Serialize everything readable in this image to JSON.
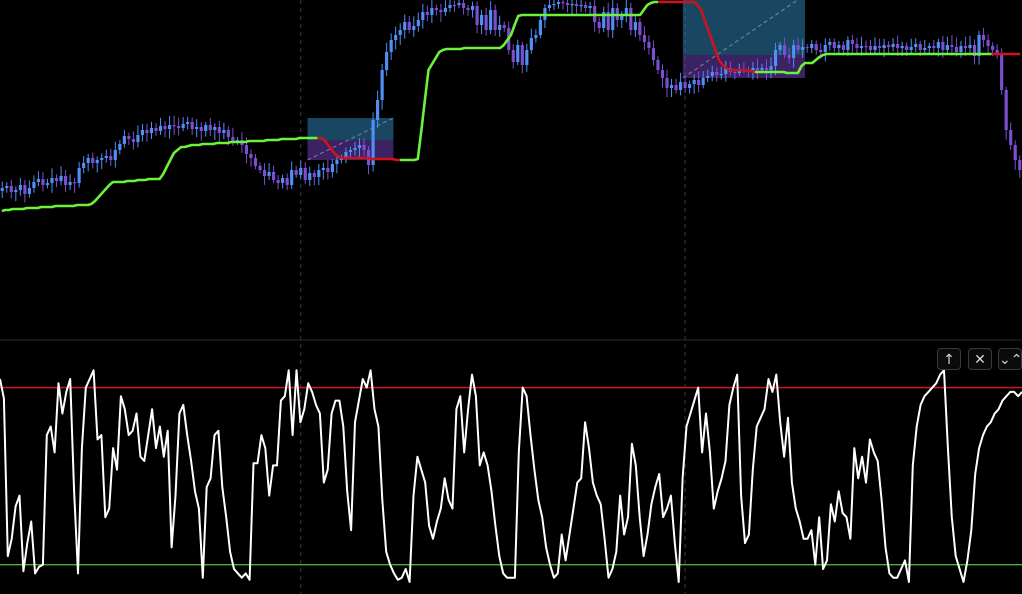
{
  "colors": {
    "background": "#000000",
    "bull_candle": "#4f8ff7",
    "bear_candle": "#7b4fd0",
    "trail_up": "#6cf23a",
    "trail_down": "#d0121f",
    "osc_line": "#ffffff",
    "upper_level": "#c41a1a",
    "lower_level": "#4caf33",
    "box_top": "#2d7fb0",
    "box_bottom": "#6b3fb5",
    "grid": "#3a3a3a"
  },
  "pane_buttons": [
    {
      "name": "move-up-icon",
      "glyph": "↑"
    },
    {
      "name": "close-icon",
      "glyph": "✕"
    },
    {
      "name": "collapse-icon",
      "glyph": "⌄⌃"
    }
  ],
  "chart_data": [
    {
      "type": "candlestick",
      "title": "",
      "price_close": [
        188,
        186,
        192,
        190,
        185,
        194,
        188,
        182,
        179,
        185,
        183,
        178,
        181,
        176,
        185,
        182,
        183,
        168,
        163,
        158,
        163,
        160,
        158,
        156,
        160,
        150,
        144,
        136,
        139,
        142,
        135,
        130,
        133,
        128,
        131,
        126,
        129,
        125,
        126,
        128,
        124,
        122,
        129,
        127,
        131,
        125,
        130,
        127,
        133,
        130,
        137,
        141,
        140,
        145,
        154,
        158,
        166,
        170,
        176,
        172,
        180,
        183,
        178,
        185,
        170,
        175,
        168,
        180,
        173,
        177,
        170,
        168,
        172,
        164,
        160,
        158,
        152,
        150,
        148,
        145,
        150,
        165,
        120,
        100,
        70,
        52,
        40,
        35,
        30,
        22,
        30,
        26,
        20,
        12,
        15,
        8,
        10,
        12,
        8,
        5,
        5,
        3,
        8,
        10,
        6,
        25,
        15,
        30,
        10,
        30,
        25,
        28,
        50,
        62,
        45,
        65,
        50,
        38,
        35,
        20,
        8,
        5,
        4,
        2,
        3,
        5,
        4,
        6,
        5,
        8,
        6,
        22,
        28,
        12,
        30,
        8,
        20,
        15,
        8,
        30,
        22,
        35,
        42,
        48,
        60,
        70,
        78,
        88,
        85,
        90,
        82,
        88,
        84,
        80,
        85,
        78,
        76,
        72,
        75,
        74,
        68,
        72,
        73,
        70,
        70,
        72,
        68,
        70,
        68,
        70,
        66,
        50,
        45,
        55,
        58,
        45,
        50,
        47,
        48,
        44,
        50,
        52,
        45,
        42,
        48,
        45,
        50,
        40,
        44,
        48,
        46,
        46,
        50,
        46,
        48,
        45,
        47,
        44,
        48,
        46,
        50,
        47,
        44,
        50,
        48,
        46,
        48,
        42,
        50,
        45,
        47,
        52,
        46,
        48,
        45,
        56,
        35,
        40,
        46,
        50,
        55,
        90,
        130,
        145,
        160,
        170
      ],
      "trail_stop": [
        211,
        210,
        210,
        209,
        209,
        209,
        209,
        208,
        208,
        208,
        208,
        207,
        207,
        207,
        207,
        206,
        206,
        206,
        206,
        206,
        206,
        205,
        205,
        205,
        205,
        204,
        201,
        197,
        193,
        189,
        185,
        182,
        182,
        182,
        182,
        181,
        181,
        181,
        180,
        180,
        180,
        179,
        179,
        179,
        179,
        174,
        167,
        160,
        153,
        150,
        147,
        147,
        146,
        145,
        145,
        145,
        144,
        144,
        144,
        144,
        143,
        143,
        143,
        143,
        142,
        142,
        142,
        142,
        142,
        141,
        141,
        141,
        141,
        141,
        140,
        140,
        140,
        140,
        139,
        139,
        139,
        139,
        139,
        138,
        138,
        138,
        138,
        138,
        138,
        138,
        140,
        145,
        150,
        154,
        157,
        158,
        158,
        158,
        158,
        158,
        158,
        158,
        158,
        159,
        159,
        159,
        159,
        159,
        159,
        159,
        160,
        160,
        160,
        160,
        160,
        160,
        159,
        130,
        100,
        70,
        64,
        58,
        52,
        50,
        49,
        49,
        49,
        49,
        49,
        48,
        48,
        48,
        48,
        48,
        48,
        48,
        48,
        48,
        48,
        48,
        45,
        40,
        35,
        25,
        16,
        15,
        15,
        15,
        15,
        15,
        15,
        15,
        15,
        15,
        15,
        15,
        15,
        15,
        15,
        15,
        15,
        15,
        15,
        15,
        15,
        15,
        15,
        15,
        15,
        15,
        15,
        15,
        15,
        15,
        15,
        15,
        15,
        15,
        15,
        10,
        5,
        3,
        2,
        2,
        2,
        2,
        2,
        2,
        2,
        2,
        2,
        2,
        2,
        2,
        5,
        10,
        20,
        30,
        40,
        50,
        60,
        65,
        68,
        70,
        70,
        70,
        70,
        70,
        71,
        71,
        72,
        72,
        72,
        72,
        72,
        72,
        72,
        72,
        72,
        73,
        73,
        73,
        73,
        66,
        63,
        63,
        63,
        60,
        57,
        55,
        54,
        54,
        54,
        54,
        54,
        54,
        54,
        54,
        54,
        54,
        54,
        54,
        54,
        54,
        54,
        54,
        54,
        54,
        54,
        54,
        54,
        54,
        54,
        54,
        54,
        54,
        54,
        54,
        54,
        54,
        54,
        54,
        54,
        54,
        54,
        54,
        54,
        54,
        54,
        54,
        54,
        54,
        54,
        54,
        54,
        54,
        54,
        54,
        54,
        54,
        54,
        54,
        54,
        54,
        54
      ],
      "trail_trend": [
        "up",
        "up",
        "up",
        "up",
        "up",
        "up",
        "up",
        "up",
        "up",
        "up",
        "up",
        "up",
        "up",
        "up",
        "up",
        "up",
        "up",
        "up",
        "up",
        "up",
        "up",
        "up",
        "up",
        "up",
        "up",
        "up",
        "up",
        "up",
        "up",
        "up",
        "up",
        "up",
        "up",
        "up",
        "up",
        "up",
        "up",
        "up",
        "up",
        "up",
        "up",
        "up",
        "up",
        "up",
        "up",
        "up",
        "up",
        "up",
        "up",
        "up",
        "up",
        "up",
        "up",
        "up",
        "up",
        "up",
        "up",
        "up",
        "up",
        "up",
        "up",
        "up",
        "up",
        "up",
        "up",
        "up",
        "up",
        "up",
        "up",
        "up",
        "up",
        "up",
        "up",
        "up",
        "up",
        "up",
        "up",
        "up",
        "up",
        "up",
        "up",
        "up",
        "up",
        "up",
        "up",
        "up",
        "up",
        "up",
        "up",
        "down",
        "down",
        "down",
        "down",
        "down",
        "down",
        "down",
        "down",
        "down",
        "down",
        "down",
        "down",
        "down",
        "down",
        "down",
        "down",
        "down",
        "down",
        "down",
        "down",
        "down",
        "down",
        "down",
        "up",
        "up",
        "up",
        "up",
        "up",
        "up",
        "up",
        "up",
        "up",
        "up",
        "up",
        "up",
        "up",
        "up",
        "up",
        "up",
        "up",
        "up",
        "up",
        "up",
        "up",
        "up",
        "up",
        "up",
        "up",
        "up",
        "up",
        "up",
        "up",
        "up",
        "up",
        "up",
        "up",
        "up",
        "up",
        "up",
        "up",
        "up",
        "up",
        "up",
        "up",
        "up",
        "up",
        "up",
        "up",
        "up",
        "up",
        "up",
        "up",
        "up",
        "up",
        "up",
        "up",
        "up",
        "up",
        "up",
        "up",
        "up",
        "up",
        "up",
        "up",
        "up",
        "up",
        "up",
        "up",
        "up",
        "up",
        "up",
        "up",
        "up",
        "up",
        "up",
        "down",
        "down",
        "down",
        "down",
        "down",
        "down",
        "down",
        "down",
        "down",
        "down",
        "down",
        "down",
        "down",
        "down",
        "down",
        "down",
        "down",
        "down",
        "down",
        "down",
        "down",
        "down",
        "down",
        "down",
        "down",
        "down",
        "down",
        "up",
        "up",
        "up",
        "up",
        "up",
        "up",
        "up",
        "up",
        "up",
        "up",
        "up",
        "up",
        "up",
        "up",
        "up",
        "up",
        "up",
        "up",
        "up",
        "up",
        "up",
        "up",
        "up",
        "up",
        "up",
        "up",
        "up",
        "up",
        "up",
        "up",
        "up",
        "up",
        "up",
        "up",
        "up",
        "up",
        "up",
        "up",
        "up",
        "up",
        "up",
        "up",
        "up",
        "up",
        "up",
        "up",
        "up",
        "up",
        "up",
        "up",
        "up",
        "up",
        "up",
        "up",
        "up",
        "up",
        "up",
        "up",
        "up",
        "up",
        "up",
        "up",
        "up",
        "up",
        "up",
        "up"
      ],
      "boxes": [
        {
          "start": 68,
          "end": 86,
          "upper": 118,
          "mid": 140,
          "lower": 160
        },
        {
          "start": 151,
          "end": 177,
          "upper": -5,
          "mid": 55,
          "lower": 78
        }
      ],
      "grid_x": [
        66,
        151,
        316
      ],
      "ylim": [
        0,
        340
      ]
    },
    {
      "type": "line",
      "title": "",
      "values": [
        94,
        85,
        12,
        20,
        35,
        40,
        5,
        18,
        28,
        4,
        7,
        8,
        68,
        72,
        60,
        92,
        78,
        88,
        94,
        42,
        4,
        62,
        90,
        94,
        98,
        66,
        68,
        30,
        34,
        62,
        52,
        86,
        80,
        68,
        70,
        78,
        58,
        56,
        68,
        80,
        62,
        72,
        58,
        70,
        16,
        40,
        78,
        82,
        68,
        56,
        42,
        34,
        2,
        44,
        48,
        68,
        70,
        44,
        30,
        14,
        6,
        4,
        2,
        4,
        1,
        55,
        55,
        68,
        62,
        40,
        54,
        54,
        84,
        86,
        98,
        68,
        98,
        74,
        80,
        92,
        88,
        82,
        78,
        46,
        52,
        78,
        84,
        84,
        72,
        42,
        24,
        74,
        84,
        94,
        90,
        98,
        80,
        72,
        38,
        14,
        8,
        4,
        1,
        2,
        6,
        0,
        40,
        58,
        52,
        46,
        26,
        20,
        28,
        34,
        48,
        38,
        34,
        80,
        86,
        60,
        80,
        96,
        86,
        54,
        60,
        54,
        42,
        26,
        12,
        4,
        2,
        2,
        2,
        60,
        90,
        86,
        68,
        52,
        38,
        30,
        16,
        8,
        2,
        4,
        22,
        10,
        22,
        34,
        46,
        48,
        74,
        62,
        46,
        40,
        36,
        20,
        2,
        6,
        14,
        40,
        22,
        30,
        64,
        54,
        30,
        12,
        22,
        36,
        44,
        50,
        30,
        34,
        40,
        18,
        0,
        48,
        72,
        78,
        84,
        90,
        60,
        78,
        60,
        34,
        42,
        48,
        56,
        82,
        90,
        96,
        40,
        18,
        22,
        52,
        72,
        76,
        80,
        94,
        88,
        96,
        74,
        58,
        76,
        46,
        34,
        28,
        20,
        20,
        24,
        8,
        30,
        6,
        10,
        36,
        28,
        42,
        32,
        30,
        20,
        62,
        48,
        58,
        46,
        66,
        60,
        56,
        38,
        16,
        4,
        2,
        2,
        6,
        10,
        0,
        54,
        72,
        82,
        86,
        88,
        90,
        92,
        96,
        98,
        62,
        30,
        12,
        6,
        0,
        10,
        24,
        50,
        62,
        68,
        72,
        74,
        78,
        80,
        84,
        86,
        88,
        88,
        86,
        88
      ],
      "upper_level": 90,
      "lower_level": 8,
      "ylim": [
        0,
        100
      ]
    }
  ]
}
